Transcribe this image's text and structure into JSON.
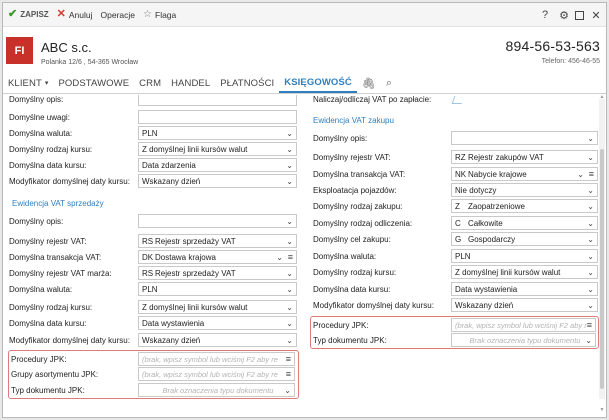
{
  "toolbar": {
    "save": "ZAPISZ",
    "cancel": "Anuluj",
    "operations": "Operacje",
    "flag": "Flaga",
    "help": "?"
  },
  "header": {
    "avatar": "FI",
    "company": "ABC s.c.",
    "address": "Polanka 12/6 , 54-365 Wrocław",
    "phone": "894-56-53-563",
    "phone2": "Telefon: 456-46-55"
  },
  "tabs": [
    "KLIENT",
    "PODSTAWOWE",
    "CRM",
    "HANDEL",
    "PŁATNOŚCI",
    "KSIĘGOWOŚĆ"
  ],
  "left": {
    "r1": {
      "label": "Domyślny opis:",
      "value": ""
    },
    "r2": {
      "label": "Domyślne uwagi:",
      "value": ""
    },
    "r3": {
      "label": "Domyślna waluta:",
      "value": "PLN"
    },
    "r4": {
      "label": "Domyślny rodzaj kursu:",
      "value": "Z domyślnej linii kursów walut"
    },
    "r5": {
      "label": "Domyślna data kursu:",
      "value": "Data zdarzenia"
    },
    "r6": {
      "label": "Modyfikator domyślnej daty kursu:",
      "value": "Wskazany dzień"
    },
    "section": "Ewidencja VAT sprzedaży",
    "s1": {
      "label": "Domyślny opis:",
      "value": ""
    },
    "s2": {
      "label": "Domyślny rejestr VAT:",
      "code": "RS",
      "value": "Rejestr sprzedaży VAT"
    },
    "s3": {
      "label": "Domyślna transakcja VAT:",
      "code": "DK",
      "value": "Dostawa krajowa"
    },
    "s4": {
      "label": "Domyślny rejestr VAT marża:",
      "code": "RS",
      "value": "Rejestr sprzedaży VAT"
    },
    "s5": {
      "label": "Domyślna waluta:",
      "value": "PLN"
    },
    "s6": {
      "label": "Domyślny rodzaj kursu:",
      "value": "Z domyślnej linii kursów walut"
    },
    "s7": {
      "label": "Domyślna data kursu:",
      "value": "Data wystawienia"
    },
    "s8": {
      "label": "Modyfikator domyślnej daty kursu:",
      "value": "Wskazany dzień"
    },
    "j1": {
      "label": "Procedury JPK:",
      "placeholder": "(brak, wpisz symbol lub wciśnij F2 aby re"
    },
    "j2": {
      "label": "Grupy asortymentu JPK:",
      "placeholder": "(brak, wpisz symbol lub wciśnij F2 aby re"
    },
    "j3": {
      "label": "Typ dokumentu JPK:",
      "placeholder": "Brak oznaczenia typu dokumentu"
    }
  },
  "right": {
    "top": {
      "label": "Naliczaj/odliczaj VAT po zapłacie:"
    },
    "section": "Ewidencja VAT zakupu",
    "p1": {
      "label": "Domyślny opis:",
      "value": ""
    },
    "p2": {
      "label": "Domyślny rejestr VAT:",
      "code": "RZ",
      "value": "Rejestr zakupów VAT"
    },
    "p3": {
      "label": "Domyślna transakcja VAT:",
      "code": "NK",
      "value": "Nabycie krajowe"
    },
    "p4": {
      "label": "Eksploatacja pojazdów:",
      "value": "Nie dotyczy"
    },
    "p5": {
      "label": "Domyślny rodzaj zakupu:",
      "code": "Z",
      "value": "Zaopatrzeniowe"
    },
    "p6": {
      "label": "Domyślny rodzaj odliczenia:",
      "code": "C",
      "value": "Całkowite"
    },
    "p7": {
      "label": "Domyślny cel zakupu:",
      "code": "G",
      "value": "Gospodarczy"
    },
    "p8": {
      "label": "Domyślna waluta:",
      "value": "PLN"
    },
    "p9": {
      "label": "Domyślny rodzaj kursu:",
      "value": "Z domyślnej linii kursów walut"
    },
    "p10": {
      "label": "Domyślna data kursu:",
      "value": "Data wystawienia"
    },
    "p11": {
      "label": "Modyfikator domyślnej daty kursu:",
      "value": "Wskazany dzień"
    },
    "j1": {
      "label": "Procedury JPK:",
      "placeholder": "(brak, wpisz symbol lub wciśnij F2 aby re"
    },
    "j2": {
      "label": "Typ dokumentu JPK:",
      "placeholder": "Brak oznaczenia typu dokumentu"
    }
  },
  "colors": {
    "accent": "#2f7fc0",
    "brand": "#c8312a",
    "highlight": "#e07a7a"
  }
}
